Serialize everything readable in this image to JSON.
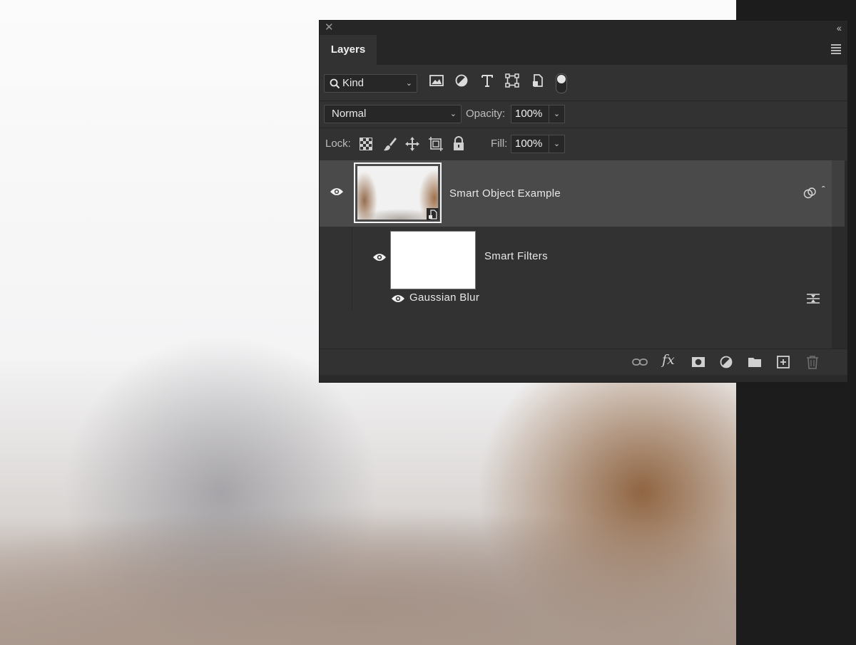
{
  "panel": {
    "tab_label": "Layers",
    "filter": {
      "kind_label": "Kind"
    },
    "blend_mode": "Normal",
    "opacity_label": "Opacity:",
    "opacity_value": "100%",
    "lock_label": "Lock:",
    "fill_label": "Fill:",
    "fill_value": "100%"
  },
  "layers": {
    "smart_object_name": "Smart Object Example",
    "smart_filters_label": "Smart Filters",
    "filter_effect_name": "Gaussian Blur"
  },
  "icons": {
    "filter_pixel": "image-icon",
    "filter_adjustment": "half-circle-icon",
    "filter_type": "type-icon",
    "filter_shape": "transform-icon",
    "filter_smart_object": "smart-object-icon",
    "lock_transparency": "checkerboard-icon",
    "lock_image": "brush-icon",
    "lock_position": "move-icon",
    "lock_artboard": "artboard-icon",
    "lock_all": "lock-icon",
    "bottom_link": "link-icon",
    "bottom_fx": "fx-icon",
    "bottom_mask": "mask-icon",
    "bottom_adjustment": "adjustment-icon",
    "bottom_group": "folder-icon",
    "bottom_new": "new-layer-icon",
    "bottom_delete": "trash-icon"
  },
  "colors": {
    "panel_bg": "#323232",
    "selected_row": "#4a4a4a",
    "titlebar": "#262626"
  }
}
